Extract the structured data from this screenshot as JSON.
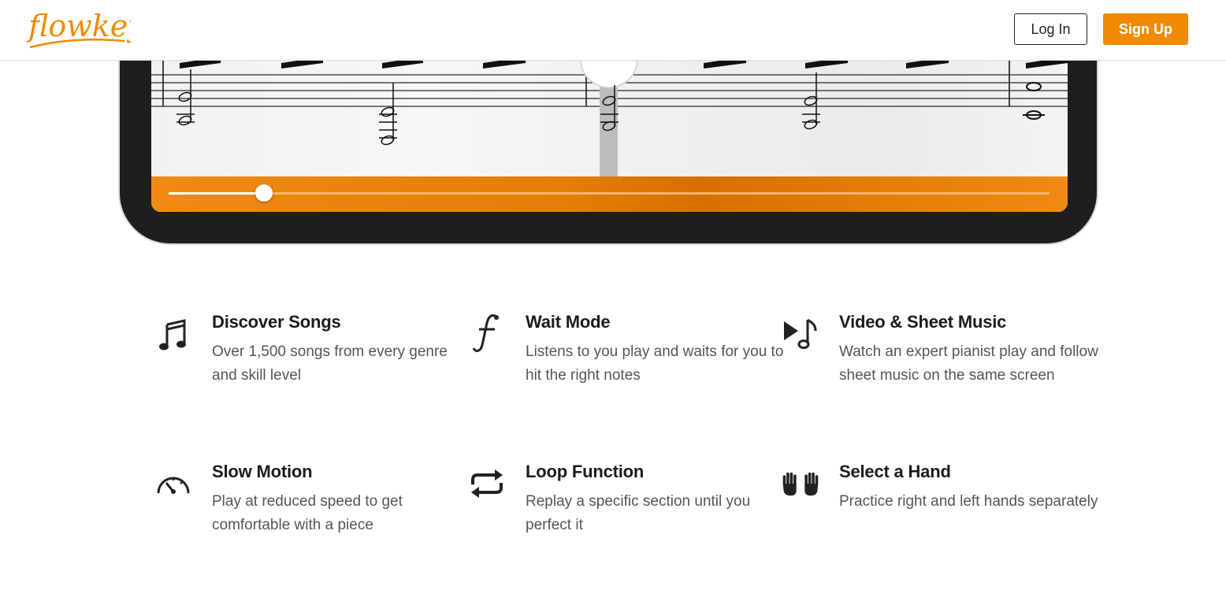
{
  "header": {
    "logo_text": "flowkey",
    "login_label": "Log In",
    "signup_label": "Sign Up",
    "brand_color": "#f08a00"
  },
  "player": {
    "progress": 0.108
  },
  "features": [
    {
      "icon": "music-note-icon",
      "title": "Discover Songs",
      "description": "Over 1,500 songs from every genre and skill level"
    },
    {
      "icon": "forte-icon",
      "title": "Wait Mode",
      "description": "Listens to you play and waits for you to hit the right notes"
    },
    {
      "icon": "video-sheet-icon",
      "title": "Video & Sheet Music",
      "description": "Watch an expert pianist play and follow sheet music on the same screen"
    },
    {
      "icon": "speedometer-icon",
      "title": "Slow Motion",
      "description": "Play at reduced speed to get comfortable with a piece"
    },
    {
      "icon": "loop-icon",
      "title": "Loop Function",
      "description": "Replay a specific section until you perfect it"
    },
    {
      "icon": "hands-icon",
      "title": "Select a Hand",
      "description": "Practice right and left hands separately"
    }
  ]
}
